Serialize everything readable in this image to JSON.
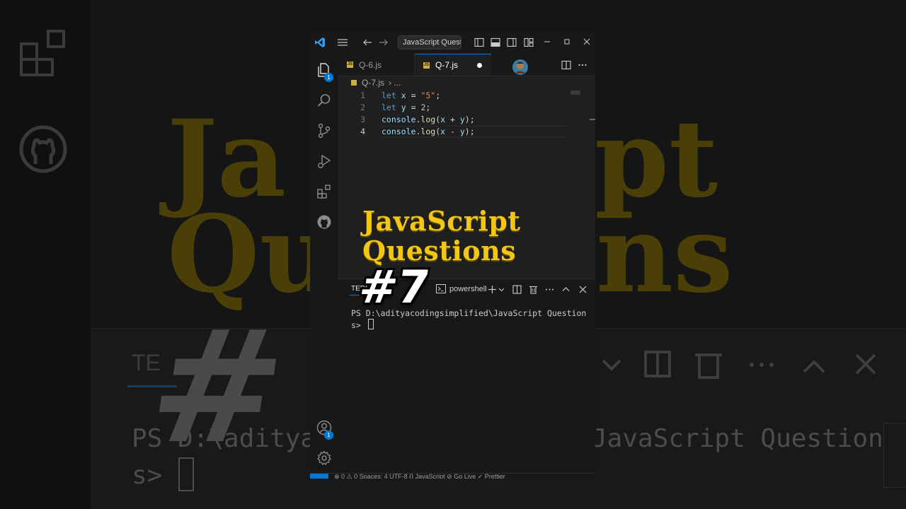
{
  "window": {
    "command_center": "JavaScript Questions"
  },
  "activity": {
    "explorer_badge": "1",
    "accounts_badge": "1"
  },
  "tabs": [
    {
      "label": "Q-6.js",
      "icon": "JS"
    },
    {
      "label": "Q-7.js",
      "icon": "JS"
    }
  ],
  "breadcrumb": {
    "file": "Q-7.js",
    "sep": "› ..."
  },
  "editor": {
    "lines": [
      {
        "n": "1",
        "parts": [
          [
            "kw",
            "let"
          ],
          [
            "op",
            " "
          ],
          [
            "var",
            "x"
          ],
          [
            "op",
            " = "
          ],
          [
            "str",
            "\"5\""
          ],
          [
            "op",
            ";"
          ]
        ]
      },
      {
        "n": "2",
        "parts": [
          [
            "kw",
            "let"
          ],
          [
            "op",
            " "
          ],
          [
            "var",
            "y"
          ],
          [
            "op",
            " = "
          ],
          [
            "num",
            "2"
          ],
          [
            "op",
            ";"
          ]
        ]
      },
      {
        "n": "3",
        "parts": [
          [
            "var",
            "console"
          ],
          [
            "op",
            "."
          ],
          [
            "fn",
            "log"
          ],
          [
            "op",
            "("
          ],
          [
            "var",
            "x"
          ],
          [
            "op",
            " + "
          ],
          [
            "var",
            "y"
          ],
          [
            "op",
            ");"
          ]
        ]
      },
      {
        "n": "4",
        "parts": [
          [
            "var",
            "console"
          ],
          [
            "op",
            "."
          ],
          [
            "fn",
            "log"
          ],
          [
            "op",
            "("
          ],
          [
            "var",
            "x"
          ],
          [
            "op",
            " - "
          ],
          [
            "var",
            "y"
          ],
          [
            "op",
            ");"
          ]
        ]
      }
    ]
  },
  "overlay": {
    "title_line1": "JavaScript",
    "title_line2": "Questions",
    "number": "#7"
  },
  "panel": {
    "tab": "TERMINAL",
    "shell": "powershell",
    "line1": "PS D:\\adityacodingsimplified\\JavaScript Question",
    "line2": "s> "
  },
  "statusbar": {
    "text": "⊗ 0  ⚠ 0    Spaces: 4   UTF-8   {} JavaScript   ⊘ Go Live   ✓ Prettier"
  },
  "colors": {
    "accent": "#0078d4",
    "title_yellow": "#f3c614",
    "editor_bg": "#1f1f1f"
  }
}
